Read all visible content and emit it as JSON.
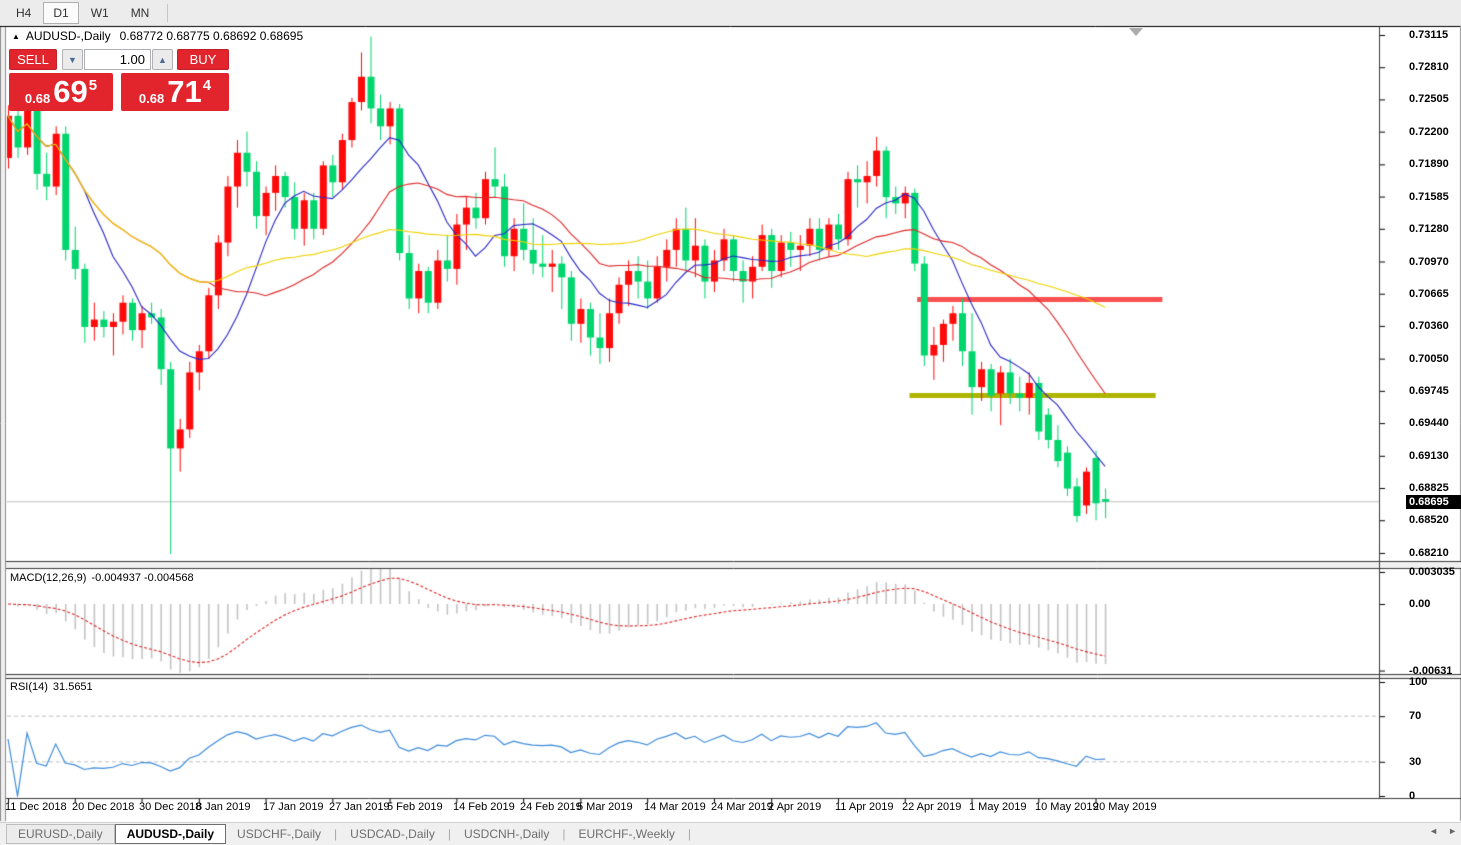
{
  "toolbar": {
    "timeframes": [
      {
        "label": "H4",
        "active": false
      },
      {
        "label": "D1",
        "active": true
      },
      {
        "label": "W1",
        "active": false
      },
      {
        "label": "MN",
        "active": false
      }
    ]
  },
  "window": {
    "title_symbol": "AUDUSD-,Daily",
    "title_ohlc": "0.68772 0.68775 0.68692 0.68695",
    "current_price": "0.68695"
  },
  "trade_panel": {
    "sell_label": "SELL",
    "buy_label": "BUY",
    "lot_value": "1.00",
    "spin_down": "▼",
    "spin_up": "▲",
    "sell_price_small": "0.68",
    "sell_price_big": "69",
    "sell_price_sup": "5",
    "buy_price_small": "0.68",
    "buy_price_big": "71",
    "buy_price_sup": "4"
  },
  "indicators": {
    "macd_label": "MACD(12,26,9)",
    "macd_values": "-0.004937 -0.004568",
    "rsi_label": "RSI(14)",
    "rsi_value": "31.5651"
  },
  "tabs": {
    "items": [
      {
        "label": "EURUSD-,Daily",
        "active": false
      },
      {
        "label": "AUDUSD-,Daily",
        "active": true
      },
      {
        "label": "USDCHF-,Daily",
        "active": false
      },
      {
        "label": "USDCAD-,Daily",
        "active": false
      },
      {
        "label": "USDCNH-,Daily",
        "active": false
      },
      {
        "label": "EURCHF-,Weekly",
        "active": false
      }
    ],
    "nav_left": "◄",
    "nav_right": "►"
  },
  "chart_data": {
    "type": "candlestick",
    "symbol": "AUDUSD-,Daily",
    "current_price": 0.68695,
    "colors": {
      "bull": "#ff0a0a",
      "bear": "#00d56e",
      "ma_fast": "#2828c8",
      "ma_mid": "#e02828",
      "ma_slow": "#f0d200",
      "macd_hist": "#c4c4c4",
      "macd_signal": "#e02828",
      "rsi_line": "#3f8cdc",
      "level_dash": "#c0c0c0",
      "price_line": "#c0c0c0",
      "badge_bg": "#000000"
    },
    "price_ticks": [
      "0.73115",
      "0.72810",
      "0.72505",
      "0.72200",
      "0.71890",
      "0.71585",
      "0.71280",
      "0.70970",
      "0.70665",
      "0.70360",
      "0.70050",
      "0.69745",
      "0.69440",
      "0.69130",
      "0.68825",
      "0.68520",
      "0.68210"
    ],
    "y_range": [
      0.6803,
      0.732
    ],
    "x_labels": [
      {
        "i": 0,
        "t": "11 Dec 2018"
      },
      {
        "i": 7,
        "t": "20 Dec 2018"
      },
      {
        "i": 14,
        "t": "30 Dec 2018"
      },
      {
        "i": 20,
        "t": "8 Jan 2019"
      },
      {
        "i": 27,
        "t": "17 Jan 2019"
      },
      {
        "i": 34,
        "t": "27 Jan 2019"
      },
      {
        "i": 40,
        "t": "5 Feb 2019"
      },
      {
        "i": 47,
        "t": "14 Feb 2019"
      },
      {
        "i": 54,
        "t": "24 Feb 2019"
      },
      {
        "i": 60,
        "t": "5 Mar 2019"
      },
      {
        "i": 67,
        "t": "14 Mar 2019"
      },
      {
        "i": 74,
        "t": "24 Mar 2019"
      },
      {
        "i": 80,
        "t": "2 Apr 2019"
      },
      {
        "i": 87,
        "t": "11 Apr 2019"
      },
      {
        "i": 94,
        "t": "22 Apr 2019"
      },
      {
        "i": 101,
        "t": "1 May 2019"
      },
      {
        "i": 108,
        "t": "10 May 2019"
      },
      {
        "i": 114,
        "t": "20 May 2019"
      }
    ],
    "candles": [
      [
        0.7195,
        0.7245,
        0.7185,
        0.7235
      ],
      [
        0.7235,
        0.7242,
        0.7195,
        0.7205
      ],
      [
        0.7205,
        0.725,
        0.7198,
        0.7242
      ],
      [
        0.7242,
        0.7248,
        0.7165,
        0.718
      ],
      [
        0.718,
        0.72,
        0.7155,
        0.7168
      ],
      [
        0.7168,
        0.7225,
        0.716,
        0.7218
      ],
      [
        0.7218,
        0.7225,
        0.7098,
        0.7108
      ],
      [
        0.7108,
        0.713,
        0.708,
        0.709
      ],
      [
        0.709,
        0.7095,
        0.702,
        0.7035
      ],
      [
        0.7035,
        0.7058,
        0.7022,
        0.7042
      ],
      [
        0.7042,
        0.705,
        0.7025,
        0.7035
      ],
      [
        0.7035,
        0.7048,
        0.7008,
        0.704
      ],
      [
        0.704,
        0.7065,
        0.7028,
        0.7058
      ],
      [
        0.7058,
        0.7062,
        0.7022,
        0.7032
      ],
      [
        0.7032,
        0.7055,
        0.7015,
        0.7048
      ],
      [
        0.7048,
        0.7058,
        0.7038,
        0.7044
      ],
      [
        0.7044,
        0.7052,
        0.698,
        0.6995
      ],
      [
        0.6995,
        0.7002,
        0.682,
        0.692
      ],
      [
        0.692,
        0.6948,
        0.6898,
        0.6938
      ],
      [
        0.6938,
        0.7002,
        0.693,
        0.6992
      ],
      [
        0.6992,
        0.7018,
        0.6975,
        0.7012
      ],
      [
        0.7012,
        0.7072,
        0.7005,
        0.7065
      ],
      [
        0.7065,
        0.7122,
        0.7052,
        0.7115
      ],
      [
        0.7115,
        0.7178,
        0.7102,
        0.7168
      ],
      [
        0.7168,
        0.7212,
        0.7148,
        0.72
      ],
      [
        0.72,
        0.722,
        0.7168,
        0.7182
      ],
      [
        0.7182,
        0.7192,
        0.7128,
        0.714
      ],
      [
        0.714,
        0.7168,
        0.7122,
        0.7162
      ],
      [
        0.7162,
        0.7188,
        0.7145,
        0.7178
      ],
      [
        0.7178,
        0.7182,
        0.7148,
        0.7158
      ],
      [
        0.7158,
        0.7172,
        0.7118,
        0.7128
      ],
      [
        0.7128,
        0.7162,
        0.7112,
        0.7155
      ],
      [
        0.7155,
        0.7162,
        0.7118,
        0.7128
      ],
      [
        0.7128,
        0.7192,
        0.7122,
        0.7188
      ],
      [
        0.7188,
        0.7198,
        0.7158,
        0.7172
      ],
      [
        0.7172,
        0.7218,
        0.7165,
        0.7212
      ],
      [
        0.7212,
        0.7252,
        0.7205,
        0.7248
      ],
      [
        0.7248,
        0.7295,
        0.724,
        0.7272
      ],
      [
        0.7272,
        0.731,
        0.7228,
        0.7242
      ],
      [
        0.7242,
        0.7255,
        0.7212,
        0.7225
      ],
      [
        0.7225,
        0.7248,
        0.7208,
        0.7242
      ],
      [
        0.7242,
        0.7246,
        0.7098,
        0.7105
      ],
      [
        0.7105,
        0.7122,
        0.7052,
        0.7062
      ],
      [
        0.7062,
        0.7095,
        0.7048,
        0.7088
      ],
      [
        0.7088,
        0.7092,
        0.7048,
        0.7058
      ],
      [
        0.7058,
        0.7108,
        0.7052,
        0.7098
      ],
      [
        0.7098,
        0.7122,
        0.7078,
        0.709
      ],
      [
        0.709,
        0.7142,
        0.7075,
        0.7132
      ],
      [
        0.7132,
        0.7158,
        0.7108,
        0.7148
      ],
      [
        0.7148,
        0.7162,
        0.7128,
        0.7138
      ],
      [
        0.7138,
        0.7182,
        0.7132,
        0.7175
      ],
      [
        0.7175,
        0.7205,
        0.7158,
        0.7168
      ],
      [
        0.7168,
        0.718,
        0.7092,
        0.7102
      ],
      [
        0.7102,
        0.7138,
        0.7088,
        0.7128
      ],
      [
        0.7128,
        0.7152,
        0.7098,
        0.7108
      ],
      [
        0.7108,
        0.7138,
        0.7085,
        0.7095
      ],
      [
        0.7095,
        0.7122,
        0.7082,
        0.7092
      ],
      [
        0.7092,
        0.7108,
        0.7068,
        0.7095
      ],
      [
        0.7095,
        0.7102,
        0.7052,
        0.7082
      ],
      [
        0.7082,
        0.7088,
        0.7022,
        0.7038
      ],
      [
        0.7038,
        0.7062,
        0.702,
        0.7052
      ],
      [
        0.7052,
        0.7058,
        0.7008,
        0.7025
      ],
      [
        0.7025,
        0.7048,
        0.7,
        0.7015
      ],
      [
        0.7015,
        0.7062,
        0.7002,
        0.7048
      ],
      [
        0.7048,
        0.7082,
        0.7038,
        0.7075
      ],
      [
        0.7075,
        0.7098,
        0.7055,
        0.7088
      ],
      [
        0.7088,
        0.7102,
        0.7062,
        0.7078
      ],
      [
        0.7078,
        0.7098,
        0.7052,
        0.7062
      ],
      [
        0.7062,
        0.7102,
        0.7058,
        0.7092
      ],
      [
        0.7092,
        0.7118,
        0.7078,
        0.7108
      ],
      [
        0.7108,
        0.7138,
        0.7092,
        0.7128
      ],
      [
        0.7128,
        0.7148,
        0.7088,
        0.7098
      ],
      [
        0.7098,
        0.7138,
        0.7082,
        0.7112
      ],
      [
        0.7112,
        0.7118,
        0.7062,
        0.7078
      ],
      [
        0.7078,
        0.7108,
        0.7068,
        0.7098
      ],
      [
        0.7098,
        0.7128,
        0.7088,
        0.7118
      ],
      [
        0.7118,
        0.7122,
        0.7078,
        0.7088
      ],
      [
        0.7088,
        0.7098,
        0.7058,
        0.7078
      ],
      [
        0.7078,
        0.7102,
        0.7062,
        0.7092
      ],
      [
        0.7092,
        0.7132,
        0.7088,
        0.7122
      ],
      [
        0.7122,
        0.7128,
        0.7072,
        0.7088
      ],
      [
        0.7088,
        0.7122,
        0.7082,
        0.7115
      ],
      [
        0.7115,
        0.7125,
        0.7092,
        0.7108
      ],
      [
        0.7108,
        0.7122,
        0.7088,
        0.7112
      ],
      [
        0.7112,
        0.7138,
        0.7102,
        0.7128
      ],
      [
        0.7128,
        0.7138,
        0.7098,
        0.7108
      ],
      [
        0.7108,
        0.7138,
        0.7102,
        0.7132
      ],
      [
        0.7132,
        0.7142,
        0.7108,
        0.7118
      ],
      [
        0.7118,
        0.7182,
        0.7112,
        0.7175
      ],
      [
        0.7175,
        0.7188,
        0.7148,
        0.7172
      ],
      [
        0.7172,
        0.7192,
        0.7152,
        0.7178
      ],
      [
        0.7178,
        0.7215,
        0.7168,
        0.7202
      ],
      [
        0.7202,
        0.7206,
        0.7138,
        0.7158
      ],
      [
        0.7158,
        0.7168,
        0.7142,
        0.7152
      ],
      [
        0.7152,
        0.7168,
        0.7138,
        0.7162
      ],
      [
        0.7162,
        0.7166,
        0.7088,
        0.7095
      ],
      [
        0.7095,
        0.7102,
        0.6998,
        0.7008
      ],
      [
        0.7008,
        0.7035,
        0.6985,
        0.7018
      ],
      [
        0.7018,
        0.7042,
        0.7002,
        0.7038
      ],
      [
        0.7038,
        0.7055,
        0.7022,
        0.7048
      ],
      [
        0.7048,
        0.7062,
        0.6998,
        0.7012
      ],
      [
        0.7012,
        0.7048,
        0.6952,
        0.6978
      ],
      [
        0.6978,
        0.7002,
        0.6965,
        0.6995
      ],
      [
        0.6995,
        0.7,
        0.6955,
        0.697
      ],
      [
        0.6972,
        0.6998,
        0.6942,
        0.6992
      ],
      [
        0.6992,
        0.7005,
        0.6962,
        0.6972
      ],
      [
        0.6972,
        0.6988,
        0.6955,
        0.6968
      ],
      [
        0.6968,
        0.6992,
        0.6952,
        0.6982
      ],
      [
        0.6982,
        0.6988,
        0.6928,
        0.6936
      ],
      [
        0.6952,
        0.6958,
        0.692,
        0.6928
      ],
      [
        0.6928,
        0.6942,
        0.6902,
        0.6908
      ],
      [
        0.6916,
        0.6922,
        0.6875,
        0.6882
      ],
      [
        0.6884,
        0.6892,
        0.685,
        0.6856
      ],
      [
        0.6866,
        0.6902,
        0.6858,
        0.6898
      ],
      [
        0.6911,
        0.6918,
        0.6852,
        0.6868
      ],
      [
        0.6872,
        0.6882,
        0.6854,
        0.68695
      ]
    ],
    "moving_averages": [
      {
        "name": "fast",
        "period": 9,
        "color": "#2828c8"
      },
      {
        "name": "medium",
        "period": 22,
        "color": "#e02828"
      },
      {
        "name": "slow",
        "period": 50,
        "color": "#f0d200"
      }
    ],
    "overlay_lines": [
      {
        "name": "resistance-segment",
        "price": 0.7061,
        "bar_start": 95.3,
        "bar_end": 121.0,
        "color": "#f85050",
        "width": 5
      },
      {
        "name": "support-segment",
        "price": 0.697,
        "bar_start": 94.5,
        "bar_end": 120.3,
        "color": "#aeb400",
        "width": 5
      }
    ],
    "macd": {
      "label": "MACD(12,26,9)",
      "params": [
        12,
        26,
        9
      ],
      "main_value": -0.004937,
      "signal_value": -0.004568,
      "ticks": [
        "0.003035",
        "0.00",
        "-0.00631"
      ],
      "range": [
        -0.0066,
        0.0031
      ]
    },
    "rsi": {
      "label": "RSI(14)",
      "period": 14,
      "value": 31.5651,
      "ticks": [
        "100",
        "70",
        "30",
        "0"
      ],
      "levels": [
        70,
        30
      ],
      "range": [
        0,
        100
      ]
    }
  }
}
